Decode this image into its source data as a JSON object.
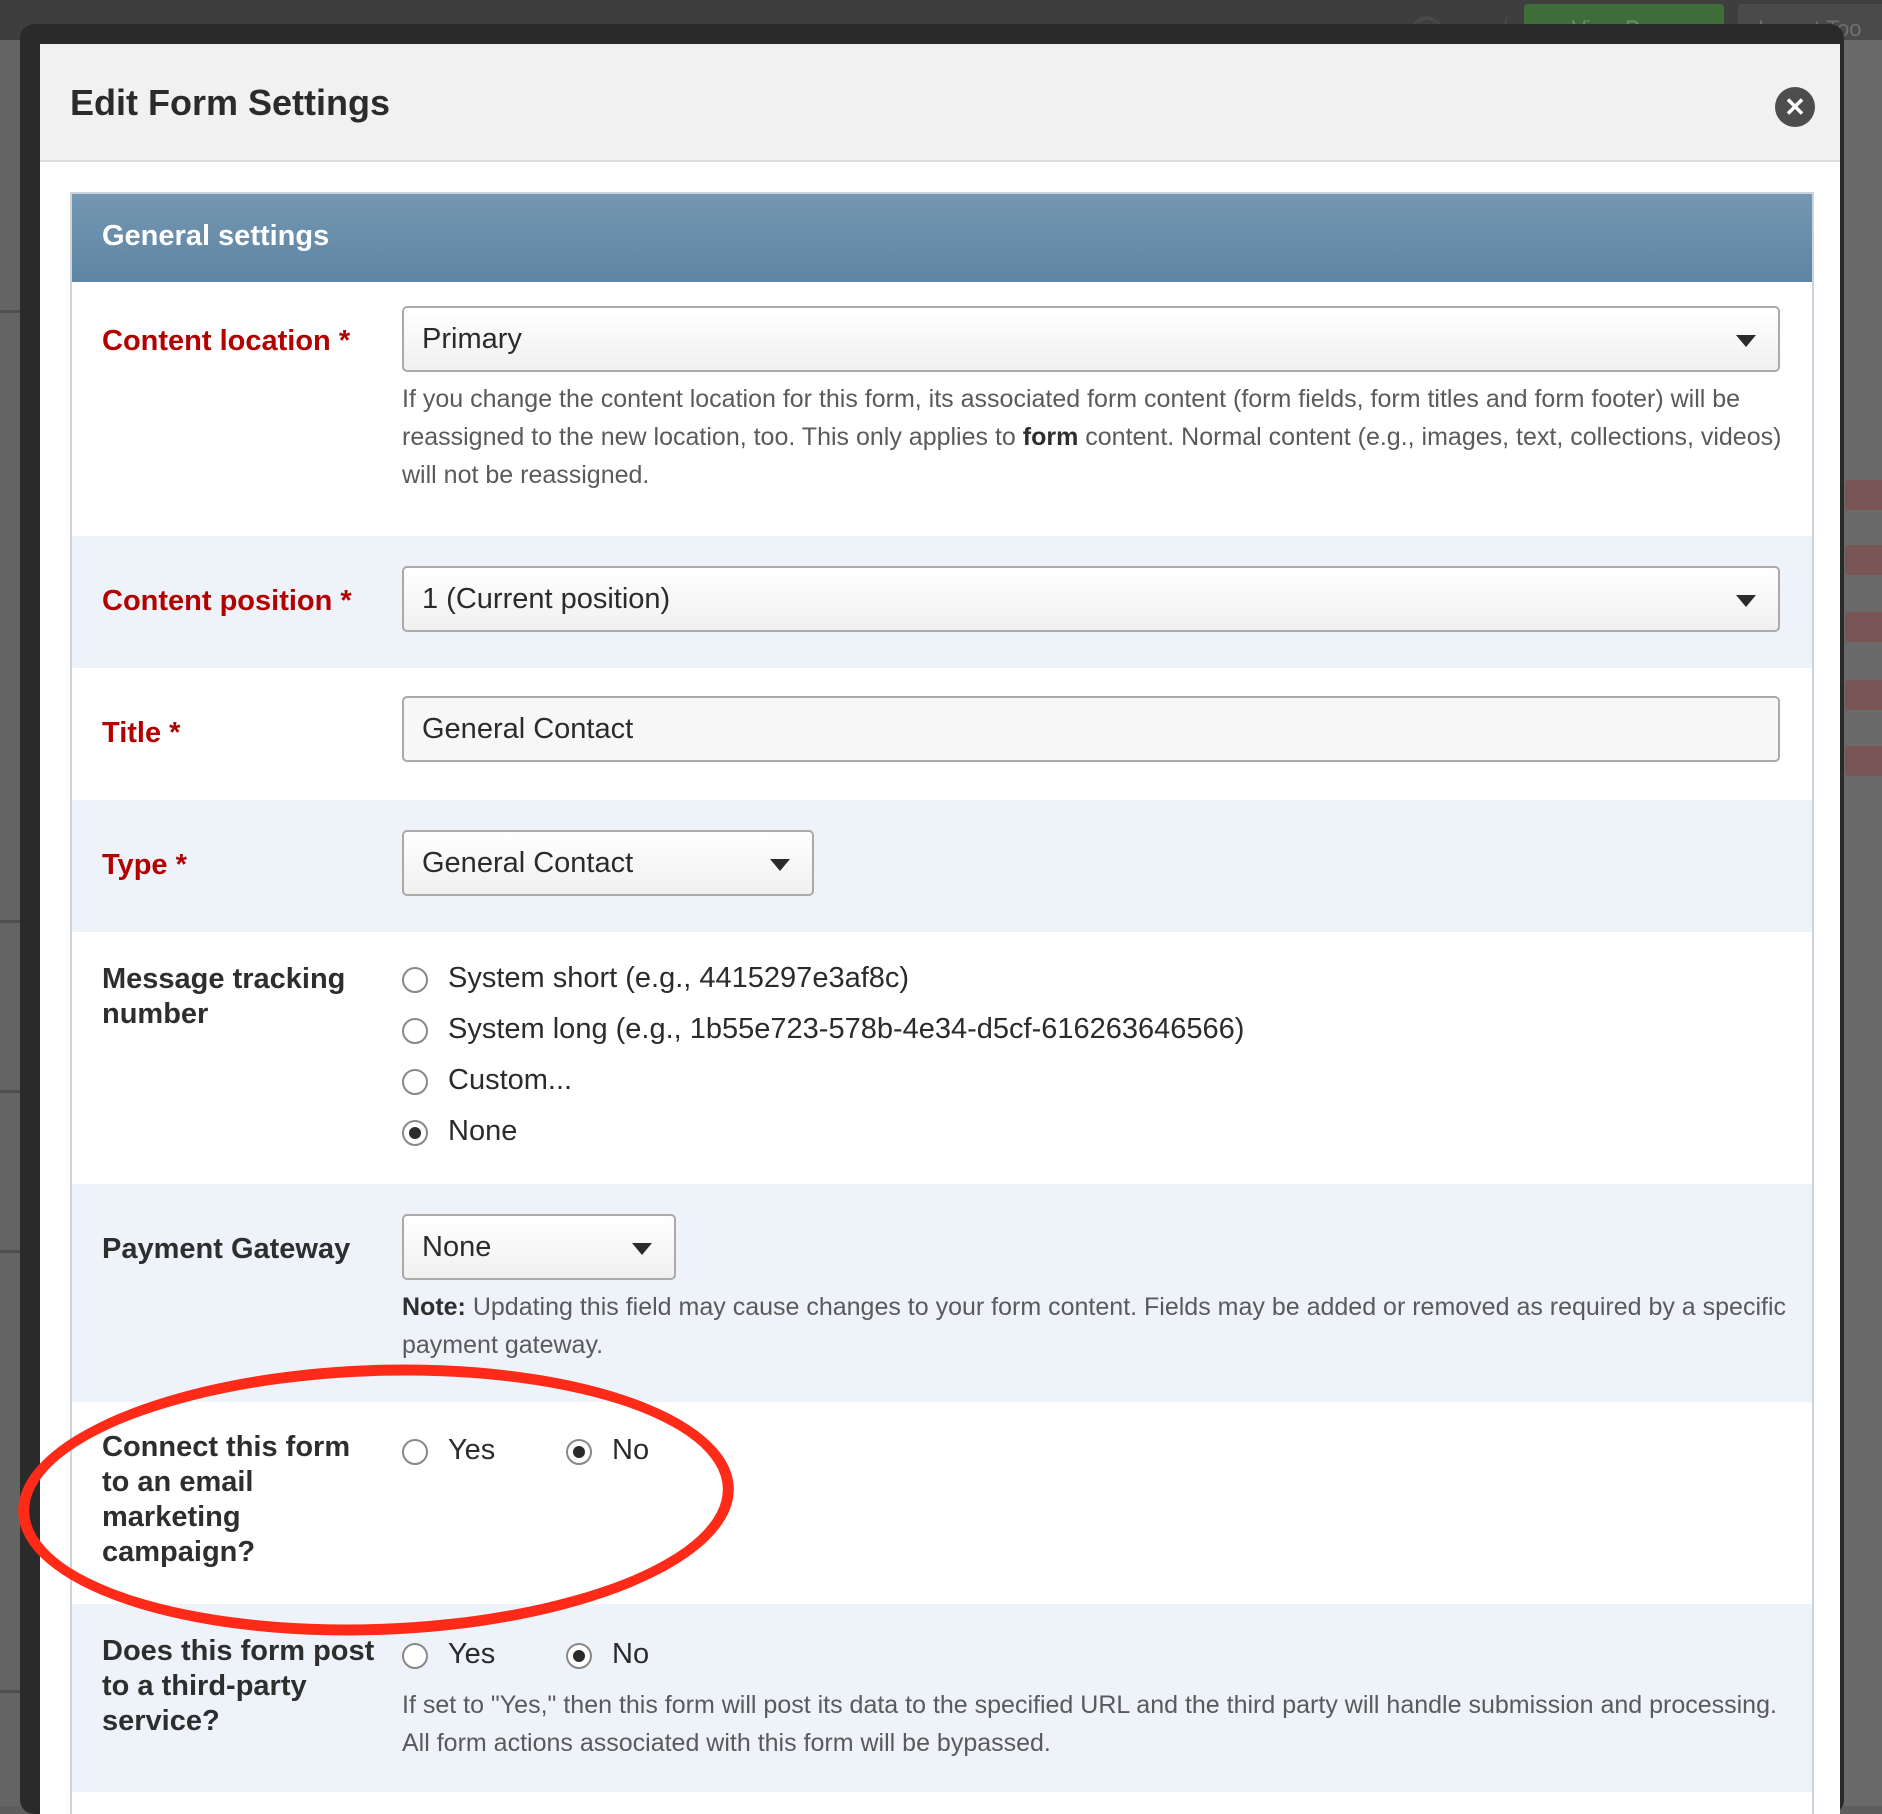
{
  "background": {
    "view_page_label": "View Page",
    "import_label": "Import Too"
  },
  "modal": {
    "title": "Edit Form Settings",
    "close_icon": "close-icon"
  },
  "panel": {
    "title": "General settings"
  },
  "fields": {
    "content_location": {
      "label": "Content location",
      "required_mark": "*",
      "value": "Primary",
      "help_part1": "If you change the content location for this form, its associated form content (form fields, form titles and form footer) will be reassigned to the new location, too. This only applies to ",
      "help_bold": "form",
      "help_part2": " content. Normal content (e.g., images, text, collections, videos) will not be reassigned."
    },
    "content_position": {
      "label": "Content position",
      "required_mark": "*",
      "value": "1 (Current position)"
    },
    "title": {
      "label": "Title",
      "required_mark": "*",
      "value": "General Contact"
    },
    "type": {
      "label": "Type",
      "required_mark": "*",
      "value": "General Contact"
    },
    "message_tracking": {
      "label_line1": "Message tracking",
      "label_line2": "number",
      "options": [
        {
          "label": "System short (e.g., 4415297e3af8c)",
          "selected": false
        },
        {
          "label": "System long (e.g., 1b55e723-578b-4e34-d5cf-616263646566)",
          "selected": false
        },
        {
          "label": "Custom...",
          "selected": false
        },
        {
          "label": "None",
          "selected": true
        }
      ]
    },
    "payment_gateway": {
      "label": "Payment Gateway",
      "value": "None",
      "note_bold": "Note:",
      "note_text": " Updating this field may cause changes to your form content. Fields may be added or removed as required by a specific payment gateway."
    },
    "email_marketing": {
      "label_lines": [
        "Connect this form",
        "to an email",
        "marketing",
        "campaign?"
      ],
      "yes_label": "Yes",
      "no_label": "No",
      "selected": "No"
    },
    "third_party": {
      "label_lines": [
        "Does this form post",
        "to a third-party",
        "service?"
      ],
      "yes_label": "Yes",
      "no_label": "No",
      "selected": "No",
      "help": "If set to \"Yes,\" then this form will post its data to the specified URL and the third party will handle submission and processing. All form actions associated with this form will be bypassed."
    }
  },
  "colors": {
    "required_label": "#b30000",
    "panel_header": "#6a8fac",
    "annotation": "#ff2a17"
  }
}
